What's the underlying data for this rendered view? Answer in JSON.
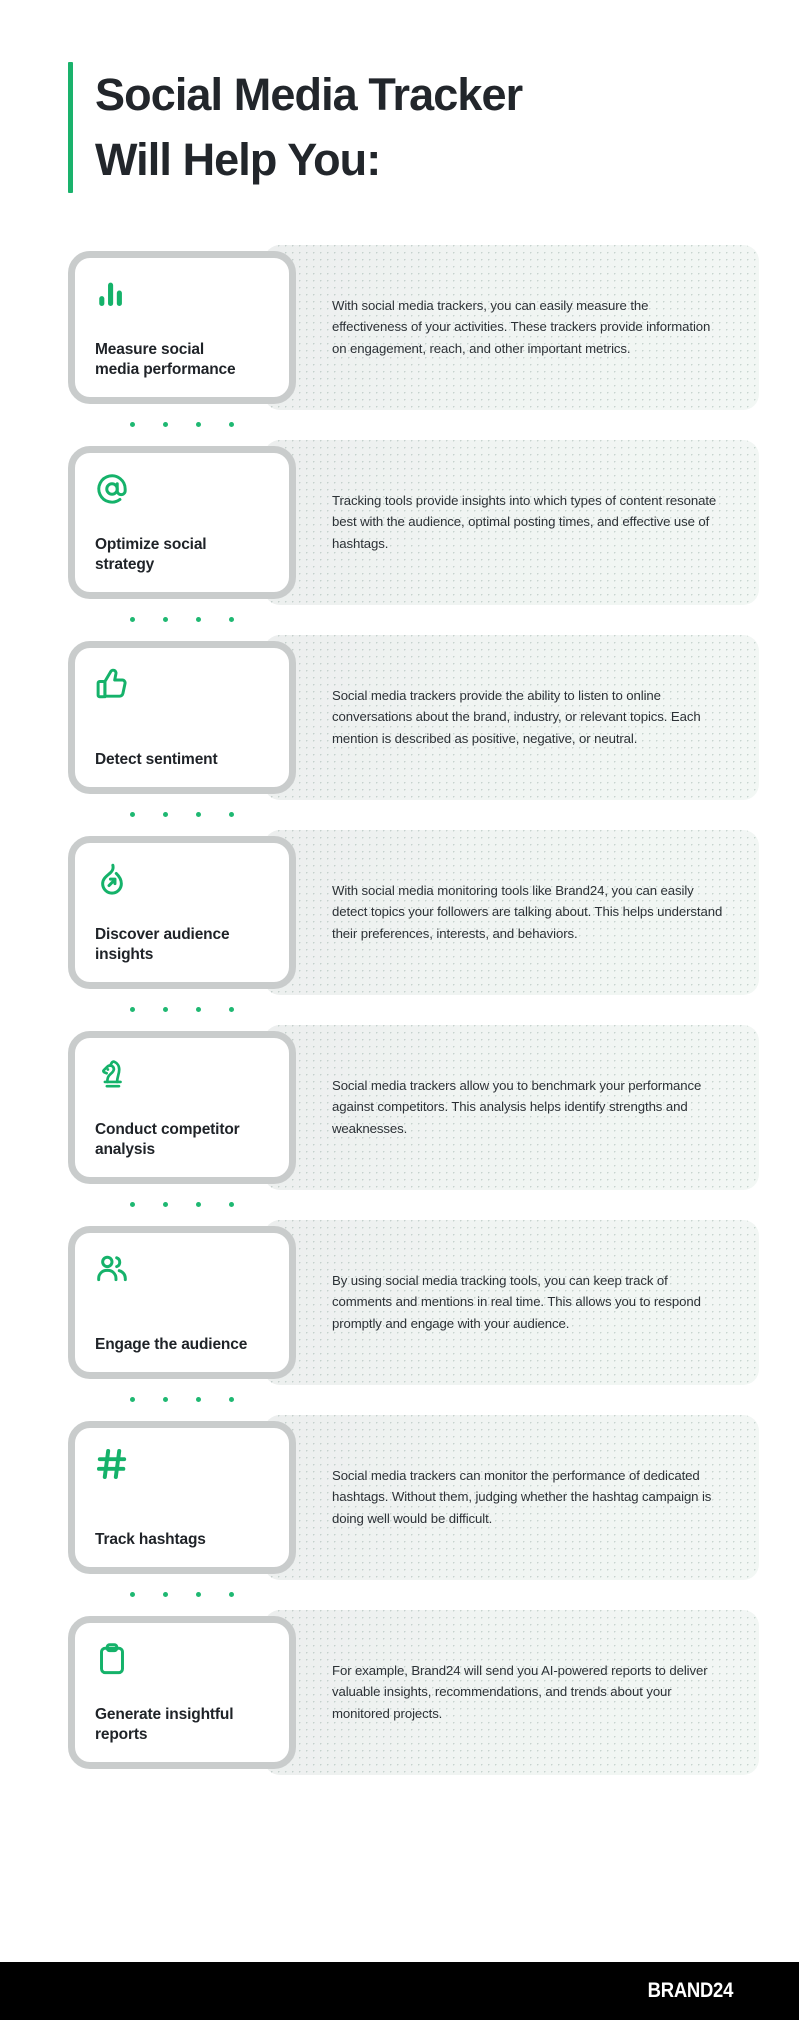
{
  "header": {
    "title": "Social Media Tracker\nWill Help You:",
    "accent_color": "#1ab26c"
  },
  "cards": [
    {
      "icon": "bar-chart-icon",
      "title": "Measure social\nmedia performance",
      "body": "With social media trackers, you can easily measure the effectiveness of your activities. These trackers provide information on engagement, reach, and other important metrics."
    },
    {
      "icon": "at-sign-icon",
      "title": "Optimize social\nstrategy",
      "body": "Tracking tools provide insights into which types of content resonate best with the audience, optimal posting times, and effective use of hashtags."
    },
    {
      "icon": "thumbs-up-icon",
      "title": "Detect sentiment",
      "body": "Social media trackers provide the ability to listen to online conversations about the brand, industry, or relevant topics. Each mention is described as positive, negative, or neutral."
    },
    {
      "icon": "flame-trend-icon",
      "title": "Discover audience\ninsights",
      "body": "With social media monitoring tools like Brand24, you can easily detect topics your followers are talking about. This helps understand their preferences, interests, and behaviors."
    },
    {
      "icon": "chess-knight-icon",
      "title": "Conduct competitor\nanalysis",
      "body": "Social media trackers allow you to benchmark your performance against competitors. This analysis helps identify strengths and weaknesses."
    },
    {
      "icon": "users-icon",
      "title": "Engage the audience",
      "body": "By using social media tracking tools, you can keep track of comments and mentions in real time. This allows you to respond promptly and engage with your audience."
    },
    {
      "icon": "hashtag-icon",
      "title": "Track hashtags",
      "body": "Social media trackers can monitor the performance of dedicated hashtags. Without them, judging whether the hashtag campaign is doing well would be difficult."
    },
    {
      "icon": "clipboard-report-icon",
      "title": "Generate insightful\nreports",
      "body": "For example, Brand24 will send you AI-powered reports to deliver valuable insights, recommendations, and trends about your monitored projects."
    }
  ],
  "separator": {
    "dot_count": 4,
    "dot_color": "#1fb872"
  },
  "footer": {
    "logo": "BRAND24",
    "background": "#000000"
  },
  "theme": {
    "accent_green": "#15b26a",
    "title_color": "#1f2328",
    "body_color": "#2c3136",
    "card_border": "#c9cccc"
  }
}
